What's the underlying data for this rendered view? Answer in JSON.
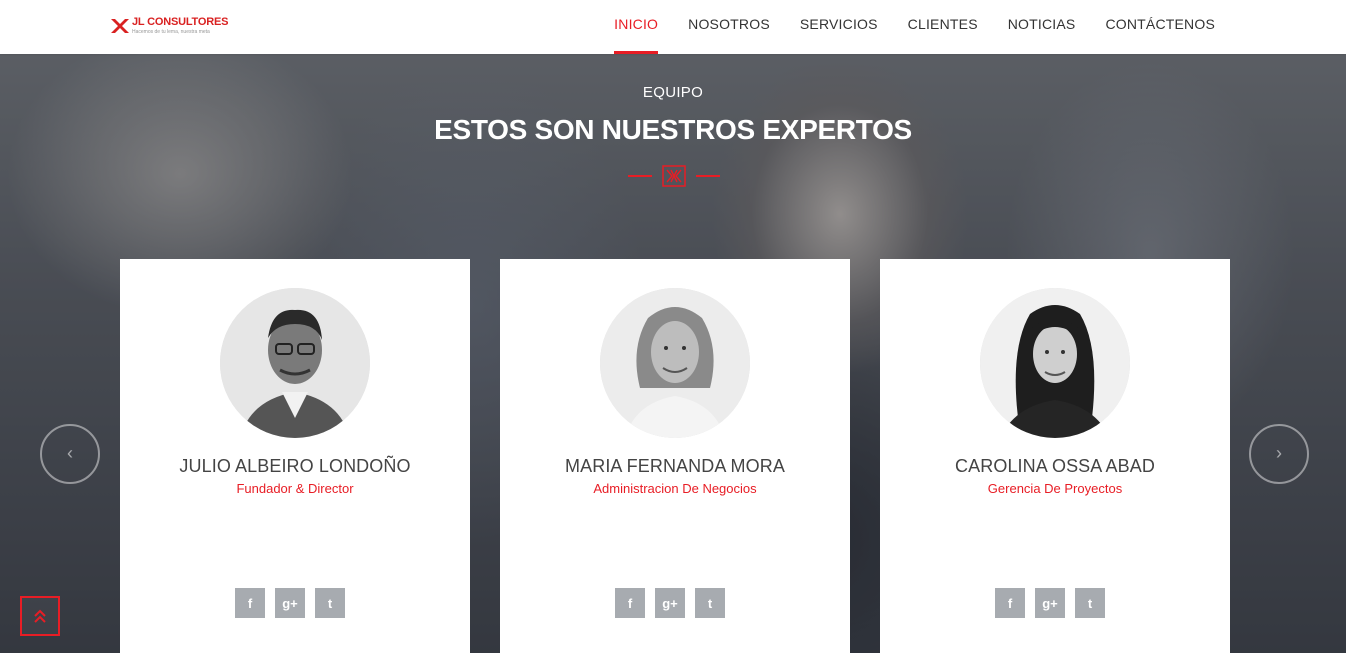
{
  "header": {
    "logo_text": "JL CONSULTORES",
    "logo_tagline": "Hacemos de tu lema, nuestra meta",
    "nav": [
      {
        "label": "INICIO",
        "active": true
      },
      {
        "label": "NOSOTROS",
        "active": false
      },
      {
        "label": "SERVICIOS",
        "active": false
      },
      {
        "label": "CLIENTES",
        "active": false
      },
      {
        "label": "NOTICIAS",
        "active": false
      },
      {
        "label": "CONTÁCTENOS",
        "active": false
      }
    ]
  },
  "section": {
    "subtitle": "EQUIPO",
    "title": "ESTOS SON NUESTROS EXPERTOS"
  },
  "team": [
    {
      "name": "JULIO ALBEIRO LONDOÑO",
      "role": "Fundador & Director"
    },
    {
      "name": "MARIA FERNANDA MORA",
      "role": "Administracion De Negocios"
    },
    {
      "name": "CAROLINA OSSA ABAD",
      "role": "Gerencia De Proyectos"
    }
  ],
  "social": {
    "facebook": "f",
    "google_plus": "g+",
    "twitter": "t"
  },
  "carousel": {
    "prev_icon": "chevron-left-icon",
    "next_icon": "chevron-right-icon"
  },
  "colors": {
    "accent": "#e81d25",
    "social_bg": "#a7abb0"
  }
}
